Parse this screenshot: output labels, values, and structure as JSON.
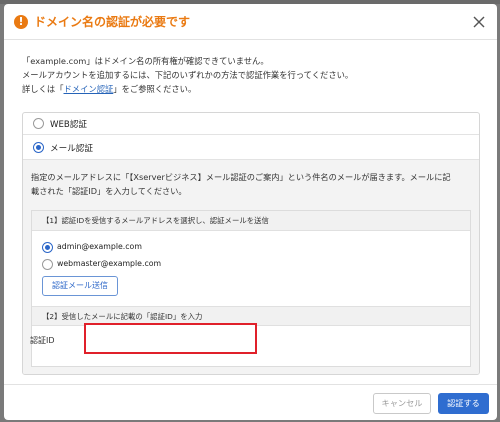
{
  "dialog": {
    "title": "ドメイン名の認証が必要です",
    "warning_icon": "!",
    "close_icon": "close-icon"
  },
  "intro": {
    "line1": "「example.com」はドメイン名の所有権が確認できていません。",
    "line2": "メールアカウントを追加するには、下記のいずれかの方法で認証作業を行ってください。",
    "line3_prefix": "詳しくは「",
    "line3_link": "ドメイン認証",
    "line3_suffix": "」をご参照ください。"
  },
  "options": {
    "web_label": "WEB認証",
    "web_selected": false,
    "mail_label": "メール認証",
    "mail_selected": true
  },
  "mail_auth": {
    "desc_line1": "指定のメールアドレスに「【Xserverビジネス】メール認証のご案内」という件名のメールが届きます。メールに記",
    "desc_line2": "載された「認証ID」を入力してください。",
    "step1_heading": "【1】認証IDを受信するメールアドレスを選択し、認証メールを送信",
    "addresses": [
      {
        "address": "admin@example.com",
        "selected": true
      },
      {
        "address": "webmaster@example.com",
        "selected": false
      }
    ],
    "send_button": "認証メール送信",
    "step2_heading": "【2】受信したメールに記載の「認証ID」を入力",
    "id_label": "認証ID",
    "id_value": "",
    "id_placeholder": ""
  },
  "footer": {
    "cancel_label": "キャンセル",
    "submit_label": "認証する"
  },
  "colors": {
    "accent": "#2f6dd0",
    "warning": "#ea7a12",
    "highlight": "#e0202a"
  }
}
